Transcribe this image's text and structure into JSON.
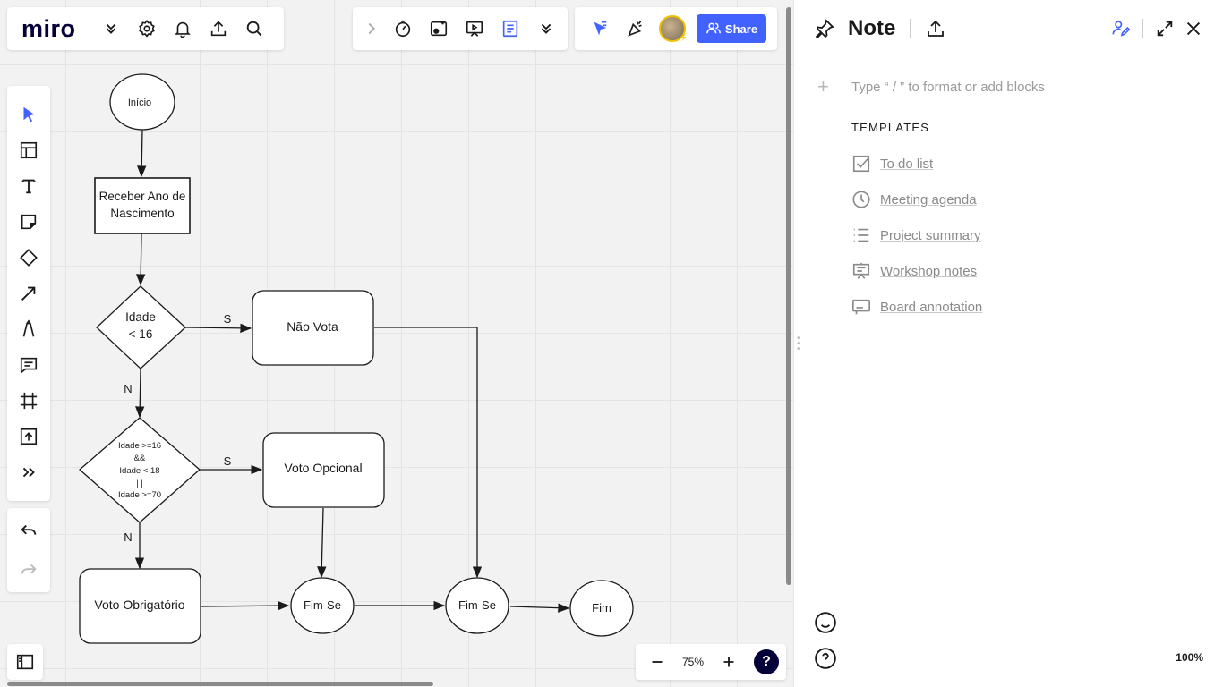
{
  "toolbar": {
    "logo": "miro",
    "share_label": "Share"
  },
  "zoom": {
    "value": "75%"
  },
  "flowchart": {
    "inicio": "Início",
    "receber_line1": "Receber Ano de",
    "receber_line2": "Nascimento",
    "decision1_line1": "Idade",
    "decision1_line2": "< 16",
    "nao_vota": "Não Vota",
    "decision2_lines": [
      "Idade >=16",
      "&&",
      "Idade < 18",
      "| |",
      "Idade >=70"
    ],
    "voto_opcional": "Voto Opcional",
    "voto_obrigatorio": "Voto Obrigatório",
    "fim_se_1": "Fim-Se",
    "fim_se_2": "Fim-Se",
    "fim": "Fim",
    "label_s1": "S",
    "label_n1": "N",
    "label_s2": "S",
    "label_n2": "N"
  },
  "note": {
    "title": "Note",
    "placeholder": "Type “ / ” to format or add blocks",
    "templates_heading": "TEMPLATES",
    "templates": [
      {
        "label": "To do list",
        "icon": "checkbox-icon"
      },
      {
        "label": "Meeting agenda",
        "icon": "clock-icon"
      },
      {
        "label": "Project summary",
        "icon": "list-icon"
      },
      {
        "label": "Workshop notes",
        "icon": "presentation-icon"
      },
      {
        "label": "Board annotation",
        "icon": "board-icon"
      }
    ],
    "zoom_pct": "100%"
  }
}
